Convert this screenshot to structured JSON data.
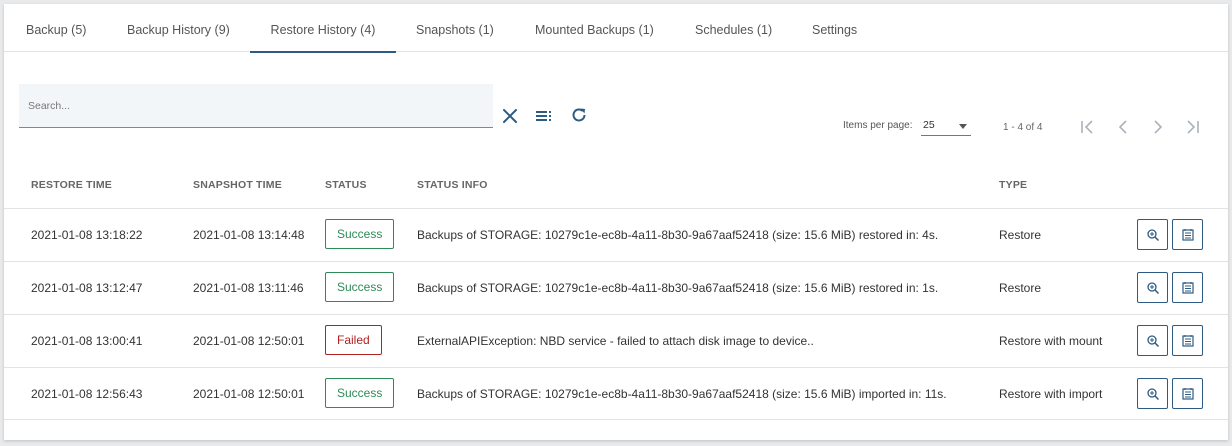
{
  "tabs": [
    {
      "label": "Backup (5)"
    },
    {
      "label": "Backup History (9)"
    },
    {
      "label": "Restore History (4)"
    },
    {
      "label": "Snapshots (1)"
    },
    {
      "label": "Mounted Backups (1)"
    },
    {
      "label": "Schedules (1)"
    },
    {
      "label": "Settings"
    }
  ],
  "active_tab": "Restore History (4)",
  "search": {
    "placeholder": "Search...",
    "value": ""
  },
  "toolbar": {
    "icons": [
      "clear-icon",
      "columns-icon",
      "refresh-icon"
    ]
  },
  "pagination": {
    "items_per_page_label": "Items per page:",
    "items_per_page": "25",
    "range": "1 - 4 of 4"
  },
  "colors": {
    "accent": "#2d5b82",
    "success": "#2e8b57",
    "failed": "#b22222"
  },
  "table": {
    "headers": [
      "RESTORE TIME",
      "SNAPSHOT TIME",
      "STATUS",
      "STATUS INFO",
      "TYPE"
    ],
    "rows": [
      {
        "restore_time": "2021-01-08 13:18:22",
        "snapshot_time": "2021-01-08 13:14:48",
        "status": "Success",
        "status_info": "Backups of STORAGE: 10279c1e-ec8b-4a11-8b30-9a67aaf52418 (size: 15.6 MiB) restored in: 4s.",
        "type": "Restore"
      },
      {
        "restore_time": "2021-01-08 13:12:47",
        "snapshot_time": "2021-01-08 13:11:46",
        "status": "Success",
        "status_info": "Backups of STORAGE: 10279c1e-ec8b-4a11-8b30-9a67aaf52418 (size: 15.6 MiB) restored in: 1s.",
        "type": "Restore"
      },
      {
        "restore_time": "2021-01-08 13:00:41",
        "snapshot_time": "2021-01-08 12:50:01",
        "status": "Failed",
        "status_info": "ExternalAPIException: NBD service - failed to attach disk image to device..",
        "type": "Restore with mount"
      },
      {
        "restore_time": "2021-01-08 12:56:43",
        "snapshot_time": "2021-01-08 12:50:01",
        "status": "Success",
        "status_info": "Backups of STORAGE: 10279c1e-ec8b-4a11-8b30-9a67aaf52418 (size: 15.6 MiB) imported in: 11s.",
        "type": "Restore with import"
      }
    ],
    "row_actions": [
      "details-icon",
      "log-icon"
    ]
  }
}
